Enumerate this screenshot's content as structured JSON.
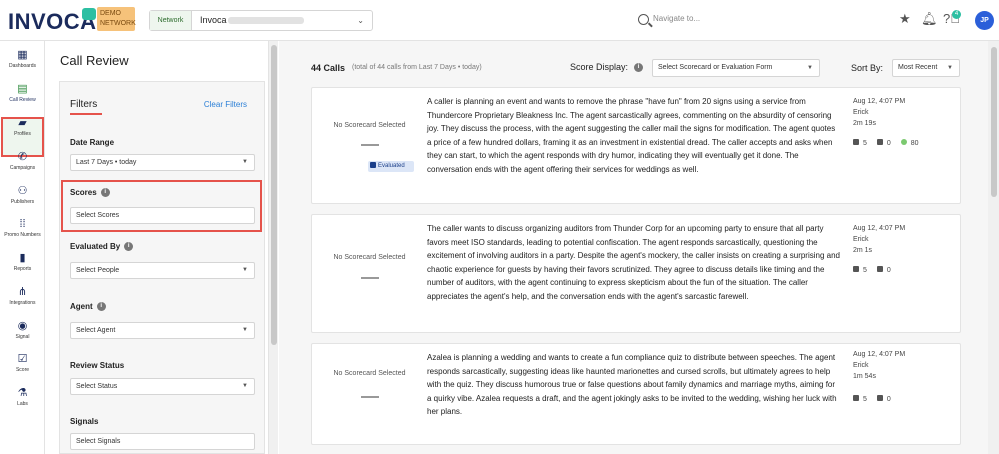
{
  "topbar": {
    "logo": "INVOCA",
    "demo_badge": "DEMO NETWORK",
    "network_label": "Network",
    "network_value": "Invoca",
    "search_placeholder": "Navigate to...",
    "help_count": "4",
    "avatar": "JP",
    "colors": {
      "accent": "#2cbfa2",
      "brand": "#1b2b5c",
      "avatar": "#2b5fd9"
    }
  },
  "nav": [
    {
      "label": "Dashboards",
      "icon": "grid-icon",
      "glyph": "▦"
    },
    {
      "label": "Call Review",
      "icon": "call-review-icon",
      "glyph": "▤"
    },
    {
      "label": "Profiles",
      "icon": "profiles-icon",
      "glyph": "▰"
    },
    {
      "label": "Campaigns",
      "icon": "phone-icon",
      "glyph": "✆"
    },
    {
      "label": "Publishers",
      "icon": "people-icon",
      "glyph": "⚇"
    },
    {
      "label": "Promo Numbers",
      "icon": "dialpad-icon",
      "glyph": "⁞⁞"
    },
    {
      "label": "Reports",
      "icon": "bar-chart-icon",
      "glyph": "▮"
    },
    {
      "label": "Integrations",
      "icon": "network-icon",
      "glyph": "⋔"
    },
    {
      "label": "Signal",
      "icon": "compass-icon",
      "glyph": "◉"
    },
    {
      "label": "Score",
      "icon": "checkbox-icon",
      "glyph": "☑"
    },
    {
      "label": "Labs",
      "icon": "flask-icon",
      "glyph": "⚗"
    }
  ],
  "panel": {
    "title": "Call Review",
    "filters_title": "Filters",
    "clear_filters": "Clear Filters",
    "date_range_label": "Date Range",
    "date_range_value": "Last 7 Days • today",
    "scores_label": "Scores",
    "scores_placeholder": "Select Scores",
    "evaluated_by_label": "Evaluated By",
    "evaluated_by_placeholder": "Select People",
    "agent_label": "Agent",
    "agent_placeholder": "Select Agent",
    "review_status_label": "Review Status",
    "review_status_placeholder": "Select Status",
    "signals_label": "Signals",
    "signals_placeholder": "Select Signals"
  },
  "main": {
    "calls_count": "44 Calls",
    "calls_sub": "(total of 44 calls from Last 7 Days • today)",
    "score_display_label": "Score Display:",
    "score_display_value": "Select Scorecard or Evaluation Form",
    "sort_label": "Sort By:",
    "sort_value": "Most Recent"
  },
  "calls": [
    {
      "scorecard": "No Scorecard Selected",
      "evaluated": "Evaluated",
      "summary": "A caller is planning an event and wants to remove the phrase \"have fun\" from 20 signs using a service from Thundercore Proprietary Bleakness Inc. The agent sarcastically agrees, commenting on the absurdity of censoring joy. They discuss the process, with the agent suggesting the caller mail the signs for modification. The agent quotes a price of a few hundred dollars, framing it as an investment in existential dread. The caller accepts and asks when they can start, to which the agent responds with dry humor, indicating they will eventually get it done. The conversation ends with the agent offering their services for weddings as well.",
      "date": "Aug 12, 4:07 PM",
      "agent": "Erick",
      "duration": "2m 19s",
      "stat_a": "5",
      "stat_b": "0",
      "stat_c": "80"
    },
    {
      "scorecard": "No Scorecard Selected",
      "summary": "The caller wants to discuss organizing auditors from Thunder Corp for an upcoming party to ensure that all party favors meet ISO standards, leading to potential confiscation. The agent responds sarcastically, questioning the excitement of involving auditors in a party. Despite the agent's mockery, the caller insists on creating a surprising and chaotic experience for guests by having their favors scrutinized. They agree to discuss details like timing and the number of auditors, with the agent continuing to express skepticism about the fun of the situation. The caller appreciates the agent's help, and the conversation ends with the agent's sarcastic farewell.",
      "date": "Aug 12, 4:07 PM",
      "agent": "Erick",
      "duration": "2m 1s",
      "stat_a": "5",
      "stat_b": "0"
    },
    {
      "scorecard": "No Scorecard Selected",
      "summary": "Azalea is planning a wedding and wants to create a fun compliance quiz to distribute between speeches. The agent responds sarcastically, suggesting ideas like haunted marionettes and cursed scrolls, but ultimately agrees to help with the quiz. They discuss humorous true or false questions about family dynamics and marriage myths, aiming for a quirky vibe. Azalea requests a draft, and the agent jokingly asks to be invited to the wedding, wishing her luck with her plans.",
      "date": "Aug 12, 4:07 PM",
      "agent": "Erick",
      "duration": "1m 54s",
      "stat_a": "5",
      "stat_b": "0"
    }
  ]
}
